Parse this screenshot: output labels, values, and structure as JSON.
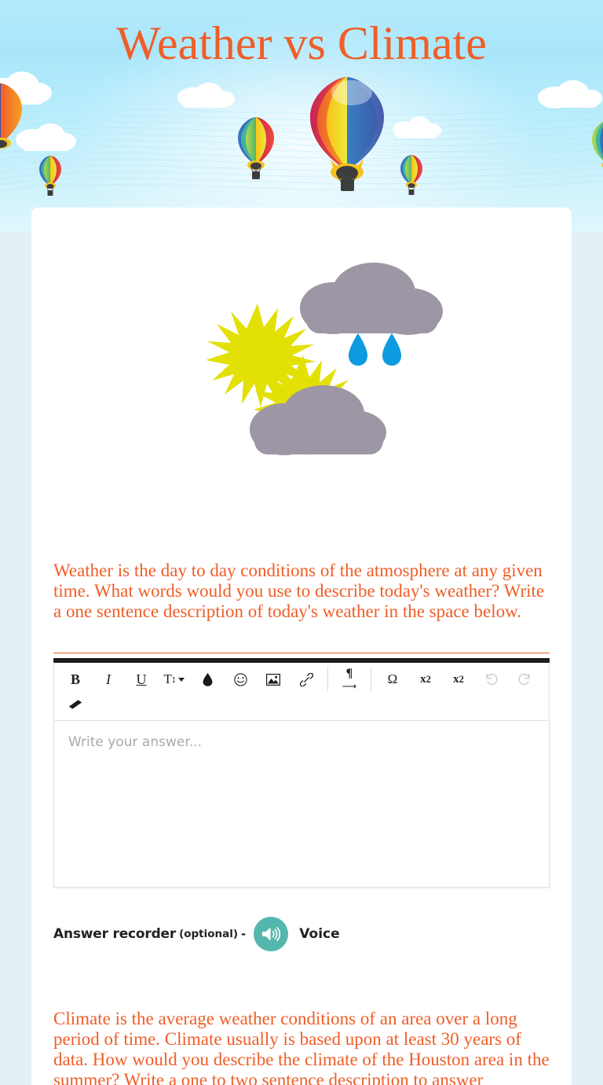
{
  "page": {
    "title": "Weather vs Climate",
    "title_color": "#ef5e28",
    "body_text_color": "#ef5e28",
    "accent_teal": "#54b7ad",
    "sky_color": "#a9e6fb",
    "page_background": "#e4f0f5"
  },
  "hero": {
    "alt": "hot-air-balloons-in-blue-sky-banner",
    "balloon_count": 6,
    "cloud_count": 4
  },
  "weather_art": {
    "alt": "weather-icons-sun-rain-cloud-partly-cloudy",
    "sun_color": "#e3e005",
    "cloud_color": "#9c96a5",
    "raindrop_color": "#0e9ade"
  },
  "questions": [
    {
      "id": "q1",
      "text": "Weather is the day to day conditions of the atmosphere at any given time.  What words would you use to describe today's weather?  Write a one sentence description of today's weather in the space below."
    },
    {
      "id": "q2",
      "text": "Climate is the average weather conditions of an area over a long period of time.  Climate usually is based upon at least 30 years of data.  How would you describe the climate of the Houston area in the summer?  Write a one to two sentence description to answer"
    }
  ],
  "editor": {
    "placeholder": "Write your answer...",
    "value": "",
    "toolbar": [
      {
        "name": "bold",
        "glyph": "B",
        "class": "tb-bold",
        "dim": false
      },
      {
        "name": "italic",
        "glyph": "I",
        "class": "tb-italic",
        "dim": false
      },
      {
        "name": "underline",
        "glyph": "U",
        "class": "tb-under",
        "dim": false
      },
      {
        "name": "font-size",
        "glyph": "T↕",
        "class": "tb-size",
        "dim": false,
        "caret": true
      },
      {
        "name": "text-color",
        "glyph": "",
        "class": "tb-color",
        "dim": false,
        "svg": "droplet"
      },
      {
        "name": "emoji",
        "glyph": "☺",
        "class": "tb-emoji",
        "dim": false
      },
      {
        "name": "insert-image",
        "glyph": "",
        "class": "tb-image",
        "dim": false,
        "svg": "image"
      },
      {
        "name": "insert-link",
        "glyph": "",
        "class": "tb-link",
        "dim": false,
        "svg": "link"
      },
      {
        "sep": true
      },
      {
        "name": "paragraph-indent",
        "glyph": "¶",
        "class": "tb-para",
        "dim": false,
        "svg": "para"
      },
      {
        "sep": true
      },
      {
        "name": "special-character",
        "glyph": "Ω",
        "class": "tb-omega",
        "dim": false
      },
      {
        "name": "subscript",
        "glyph": "",
        "class": "tb-sub",
        "dim": false,
        "html": "x<sub>2</sub>"
      },
      {
        "name": "superscript",
        "glyph": "",
        "class": "tb-sup",
        "dim": false,
        "html": "x<sup>2</sup>"
      },
      {
        "name": "undo",
        "glyph": "↺",
        "class": "tb-undo",
        "dim": true
      },
      {
        "name": "redo",
        "glyph": "↻",
        "class": "tb-redo",
        "dim": true
      },
      {
        "row_break": true
      },
      {
        "name": "clear-formatting",
        "glyph": "",
        "class": "tb-eraser",
        "dim": false,
        "svg": "eraser"
      }
    ]
  },
  "recorder": {
    "label": "Answer recorder",
    "optional": "(optional)",
    "dash": "-",
    "voice_label": "Voice",
    "icon": "speaker-icon"
  }
}
